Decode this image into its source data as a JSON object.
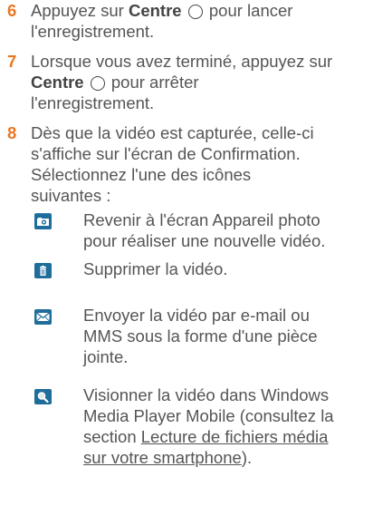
{
  "steps": [
    {
      "num": "6",
      "pre": "Appuyez sur ",
      "bold": "Centre",
      "post": " pour lancer",
      "line2": "l'enregistrement."
    },
    {
      "num": "7",
      "line1": "Lorsque vous avez terminé, appuyez sur",
      "bold": "Centre",
      "post": " pour arrêter",
      "line3": "l'enregistrement."
    },
    {
      "num": "8",
      "lines": [
        "Dès que la vidéo est capturée, celle-ci",
        "s'affiche sur l'écran de Confirmation.",
        "Sélectionnez l'une des icônes",
        "suivantes :"
      ]
    }
  ],
  "options": [
    {
      "icon": "camera-icon",
      "lines": [
        "Revenir à l'écran Appareil photo",
        "pour réaliser une nouvelle vidéo."
      ]
    },
    {
      "icon": "trash-icon",
      "lines": [
        "Supprimer la vidéo."
      ]
    },
    {
      "icon": "envelope-icon",
      "lines": [
        "Envoyer la vidéo par e-mail ou",
        "MMS sous la forme d'une pièce",
        "jointe."
      ]
    },
    {
      "icon": "magnifier-icon",
      "lines": [
        "Visionner la vidéo dans Windows",
        "Media Player Mobile (consultez la",
        "section "
      ],
      "link1": "Lecture de fichiers média",
      "link2": "sur votre smartphone",
      "tail": ")."
    }
  ],
  "colors": {
    "step_number": "#e87722",
    "text": "#555555",
    "icon_bg": "#1f6d9a"
  }
}
